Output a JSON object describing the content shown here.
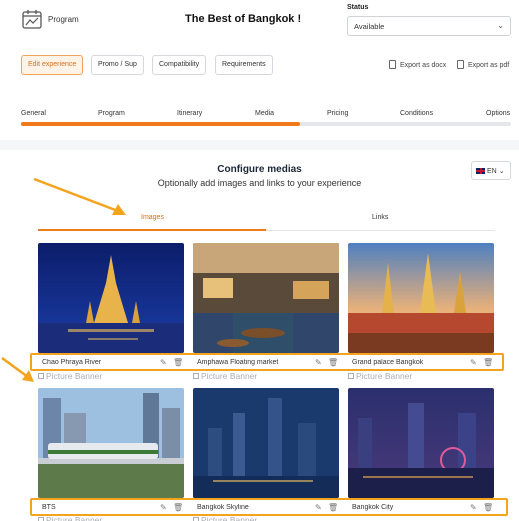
{
  "header": {
    "program_label": "Program",
    "title": "The Best of Bangkok !",
    "status_label": "Status",
    "status_value": "Available"
  },
  "actions": {
    "edit": "Edit experience",
    "promo": "Promo / Sup",
    "compat": "Compatibility",
    "req": "Requirements",
    "export_docx": "Export as docx",
    "export_pdf": "Export as pdf"
  },
  "steps": [
    "General",
    "Program",
    "Itinerary",
    "Media",
    "Pricing",
    "Conditions",
    "Options"
  ],
  "progress": 0.57,
  "configure": {
    "title": "Configure medias",
    "subtitle": "Optionally add images and links to your experience",
    "lang": "EN"
  },
  "media_tabs": {
    "images": "Images",
    "links": "Links"
  },
  "picture_banner": "Picture Banner",
  "images": [
    {
      "caption": "Chao Phraya River"
    },
    {
      "caption": "Amphawa Floating market"
    },
    {
      "caption": "Grand palace Bangkok"
    },
    {
      "caption": "BTS"
    },
    {
      "caption": "Bangkok Skyline"
    },
    {
      "caption": "Bangkok City"
    }
  ],
  "colors": {
    "accent": "#f07a1a",
    "highlight": "#f4a31c"
  },
  "icons": [
    "program-icon",
    "chevron-down-icon",
    "document-icon",
    "flag-uk-icon",
    "edit-icon",
    "trash-icon",
    "checkbox-icon",
    "arrow-annotation"
  ]
}
